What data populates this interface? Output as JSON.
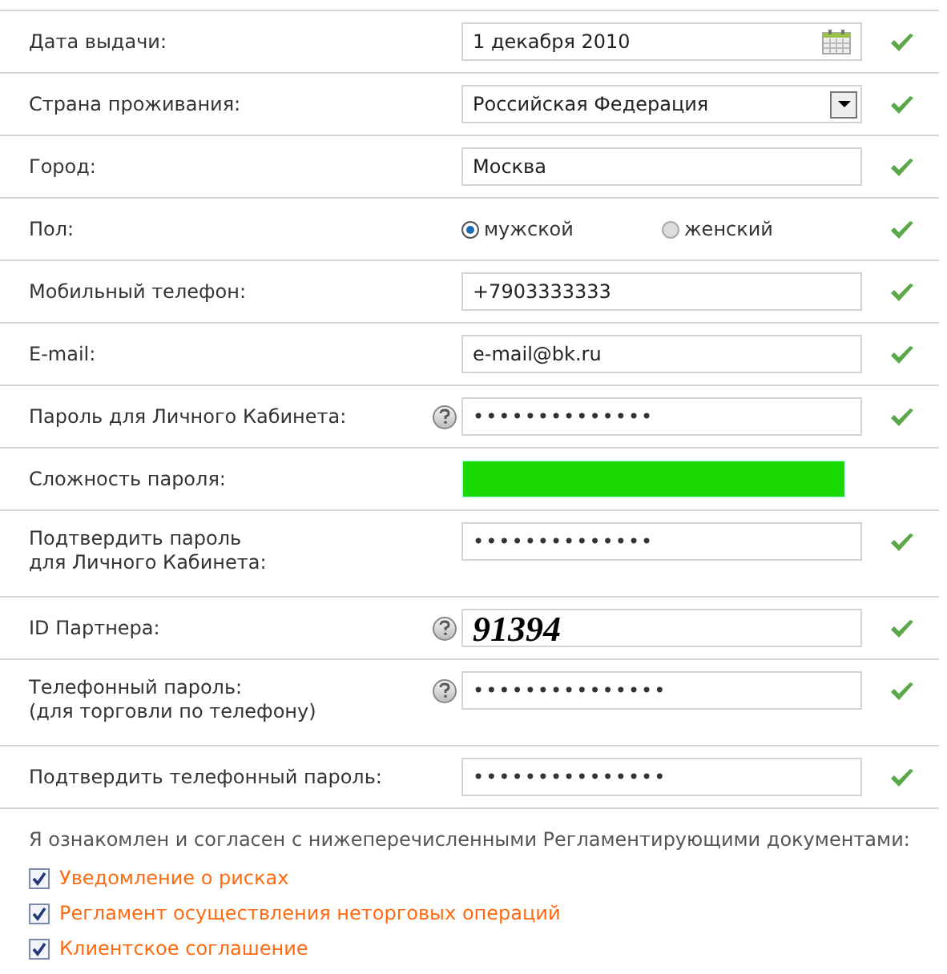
{
  "rows": [
    {
      "label": "Дата выдачи:",
      "help": false,
      "kind": "date",
      "value": "1 декабря 2010",
      "valid": true
    },
    {
      "label": "Страна проживания:",
      "help": false,
      "kind": "select",
      "value": "Российская Федерация",
      "valid": true
    },
    {
      "label": "Город:",
      "help": false,
      "kind": "text",
      "value": "Москва",
      "valid": true
    },
    {
      "label": "Пол:",
      "help": false,
      "kind": "radio",
      "options": [
        {
          "label": "мужской",
          "selected": true
        },
        {
          "label": "женский",
          "selected": false
        }
      ],
      "valid": true
    },
    {
      "label": "Мобильный телефон:",
      "help": false,
      "kind": "text",
      "value": "+7903333333",
      "valid": true
    },
    {
      "label": "E-mail:",
      "help": false,
      "kind": "text",
      "value": "e-mail@bk.ru",
      "valid": true
    },
    {
      "label": "Пароль для Личного Кабинета:",
      "help": true,
      "kind": "password",
      "value": "••••••••••••••",
      "valid": true
    },
    {
      "label": "Сложность пароля:",
      "help": false,
      "kind": "strength",
      "valid": false
    },
    {
      "label": "Подтвердить пароль\nдля Личного Кабинета:",
      "help": false,
      "kind": "password",
      "value": "••••••••••••••",
      "valid": true
    },
    {
      "label": "ID Партнера:",
      "help": true,
      "kind": "captcha",
      "value": "91394",
      "valid": true
    },
    {
      "label": "Телефонный пароль:\n(для торговли по телефону)",
      "help": true,
      "kind": "password",
      "value": "•••••••••••••••",
      "valid": true
    },
    {
      "label": "Подтвердить телефонный пароль:",
      "help": false,
      "kind": "password",
      "value": "•••••••••••••••",
      "valid": true
    }
  ],
  "agreement": {
    "intro": "Я ознакомлен и согласен с нижеперечисленными Регламентирующими документами:",
    "documents": [
      {
        "label": "Уведомление о рисках",
        "checked": true
      },
      {
        "label": "Регламент осуществления неторговых операций",
        "checked": true
      },
      {
        "label": "Клиентское соглашение",
        "checked": true
      }
    ]
  }
}
